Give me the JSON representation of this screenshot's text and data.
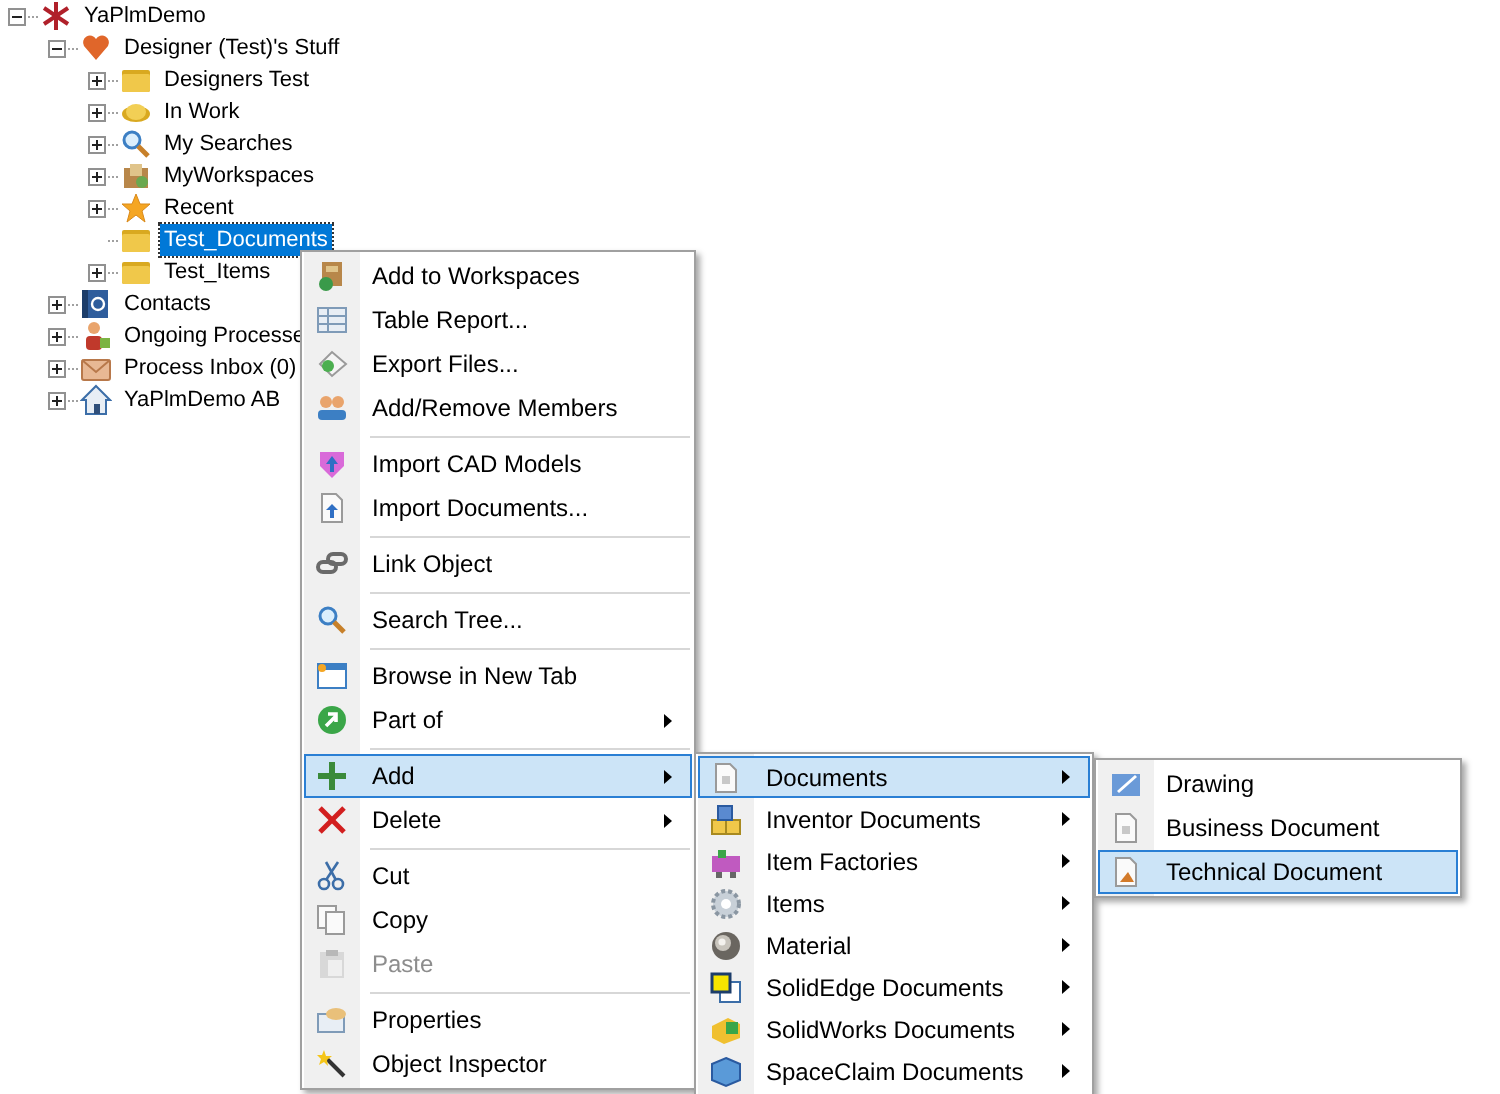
{
  "tree": [
    {
      "label": "YaPlmDemo",
      "expandable": true,
      "expanded": true,
      "selected": false,
      "children": [
        {
          "label": "Designer (Test)'s Stuff",
          "expandable": true,
          "expanded": true,
          "selected": false,
          "children": [
            {
              "label": "Designers Test",
              "expandable": true,
              "expanded": false,
              "selected": false
            },
            {
              "label": "In Work",
              "expandable": true,
              "expanded": false,
              "selected": false
            },
            {
              "label": "My Searches",
              "expandable": true,
              "expanded": false,
              "selected": false
            },
            {
              "label": "MyWorkspaces",
              "expandable": true,
              "expanded": false,
              "selected": false
            },
            {
              "label": "Recent",
              "expandable": true,
              "expanded": false,
              "selected": false
            },
            {
              "label": "Test_Documents",
              "expandable": false,
              "selected": true
            },
            {
              "label": "Test_Items",
              "expandable": true,
              "expanded": false,
              "selected": false
            }
          ]
        },
        {
          "label": "Contacts",
          "expandable": true,
          "expanded": false,
          "selected": false
        },
        {
          "label": "Ongoing Processe",
          "expandable": true,
          "expanded": false,
          "selected": false
        },
        {
          "label": "Process Inbox (0)",
          "expandable": true,
          "expanded": false,
          "selected": false
        },
        {
          "label": "YaPlmDemo AB",
          "expandable": true,
          "expanded": false,
          "selected": false
        }
      ]
    }
  ],
  "context_menu": [
    {
      "kind": "item",
      "label": "Add to Workspaces",
      "submenu": false,
      "disabled": false,
      "selected": false
    },
    {
      "kind": "item",
      "label": "Table Report...",
      "submenu": false,
      "disabled": false,
      "selected": false
    },
    {
      "kind": "item",
      "label": "Export Files...",
      "submenu": false,
      "disabled": false,
      "selected": false
    },
    {
      "kind": "item",
      "label": "Add/Remove Members",
      "submenu": false,
      "disabled": false,
      "selected": false
    },
    {
      "kind": "separator"
    },
    {
      "kind": "item",
      "label": "Import CAD Models",
      "submenu": false,
      "disabled": false,
      "selected": false
    },
    {
      "kind": "item",
      "label": "Import Documents...",
      "submenu": false,
      "disabled": false,
      "selected": false
    },
    {
      "kind": "separator"
    },
    {
      "kind": "item",
      "label": "Link Object",
      "submenu": false,
      "disabled": false,
      "selected": false
    },
    {
      "kind": "separator"
    },
    {
      "kind": "item",
      "label": "Search Tree...",
      "submenu": false,
      "disabled": false,
      "selected": false
    },
    {
      "kind": "separator"
    },
    {
      "kind": "item",
      "label": "Browse in New Tab",
      "submenu": false,
      "disabled": false,
      "selected": false
    },
    {
      "kind": "item",
      "label": "Part of",
      "submenu": true,
      "disabled": false,
      "selected": false
    },
    {
      "kind": "separator"
    },
    {
      "kind": "item",
      "label": "Add",
      "submenu": true,
      "disabled": false,
      "selected": true
    },
    {
      "kind": "item",
      "label": "Delete",
      "submenu": true,
      "disabled": false,
      "selected": false
    },
    {
      "kind": "separator"
    },
    {
      "kind": "item",
      "label": "Cut",
      "submenu": false,
      "disabled": false,
      "selected": false
    },
    {
      "kind": "item",
      "label": "Copy",
      "submenu": false,
      "disabled": false,
      "selected": false
    },
    {
      "kind": "item",
      "label": "Paste",
      "submenu": false,
      "disabled": true,
      "selected": false
    },
    {
      "kind": "separator"
    },
    {
      "kind": "item",
      "label": "Properties",
      "submenu": false,
      "disabled": false,
      "selected": false
    },
    {
      "kind": "item",
      "label": "Object Inspector",
      "submenu": false,
      "disabled": false,
      "selected": false
    }
  ],
  "add_submenu": [
    {
      "kind": "item",
      "label": "Documents",
      "submenu": true,
      "disabled": false,
      "selected": true
    },
    {
      "kind": "item",
      "label": "Inventor Documents",
      "submenu": true,
      "disabled": false,
      "selected": false
    },
    {
      "kind": "item",
      "label": "Item Factories",
      "submenu": true,
      "disabled": false,
      "selected": false
    },
    {
      "kind": "item",
      "label": "Items",
      "submenu": true,
      "disabled": false,
      "selected": false
    },
    {
      "kind": "item",
      "label": "Material",
      "submenu": true,
      "disabled": false,
      "selected": false
    },
    {
      "kind": "item",
      "label": "SolidEdge Documents",
      "submenu": true,
      "disabled": false,
      "selected": false
    },
    {
      "kind": "item",
      "label": "SolidWorks Documents",
      "submenu": true,
      "disabled": false,
      "selected": false
    },
    {
      "kind": "item",
      "label": "SpaceClaim Documents",
      "submenu": true,
      "disabled": false,
      "selected": false
    }
  ],
  "documents_submenu": [
    {
      "kind": "item",
      "label": "Drawing",
      "submenu": false,
      "disabled": false,
      "selected": false
    },
    {
      "kind": "item",
      "label": "Business Document",
      "submenu": false,
      "disabled": false,
      "selected": false
    },
    {
      "kind": "item",
      "label": "Technical Document",
      "submenu": false,
      "disabled": false,
      "selected": true
    }
  ]
}
